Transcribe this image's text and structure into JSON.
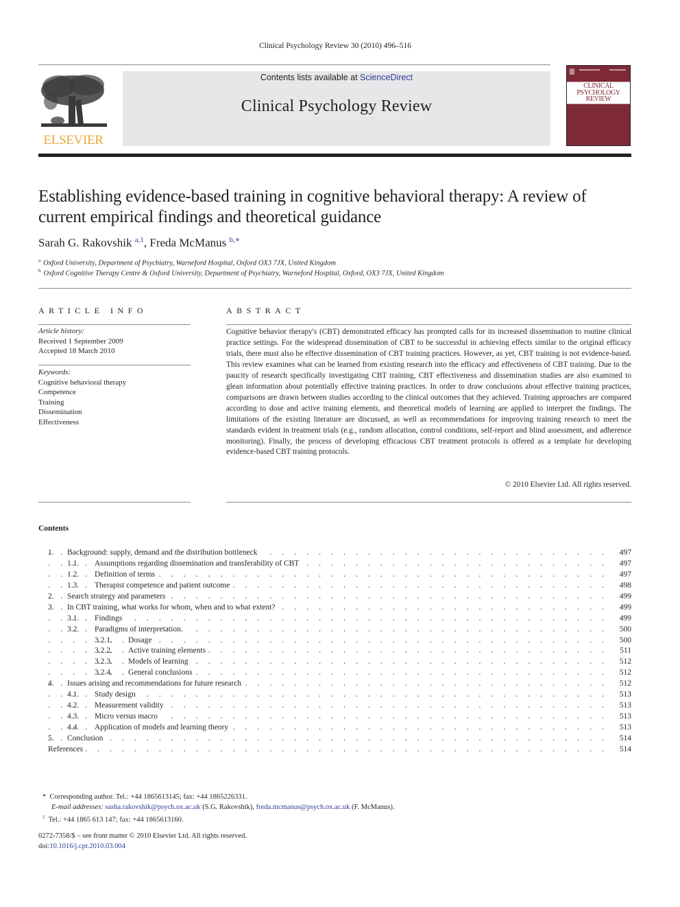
{
  "header": {
    "citation": "Clinical Psychology Review 30 (2010) 496–516",
    "contents_available_prefix": "Contents lists available at ",
    "sciencedirect_link": "ScienceDirect",
    "journal_title": "Clinical Psychology Review",
    "publisher_logo_text": "ELSEVIER",
    "cover_title_lines": [
      "CLINICAL",
      "PSYCHOLOGY",
      "REVIEW"
    ]
  },
  "article": {
    "title": "Establishing evidence-based training in cognitive behavioral therapy: A review of current empirical findings and theoretical guidance",
    "authors": [
      {
        "name": "Sarah G. Rakovshik",
        "sup": "a,1"
      },
      {
        "name": "Freda McManus",
        "sup": "b,∗"
      }
    ],
    "author_separator": ", ",
    "affiliations": [
      {
        "mark": "a",
        "text": "Oxford University, Department of Psychiatry, Warneford Hospital, Oxford OX3 7JX, United Kingdom"
      },
      {
        "mark": "b",
        "text": "Oxford Cognitive Therapy Centre & Oxford University, Department of Psychiatry, Warneford Hospital, Oxford, OX3 7JX, United Kingdom"
      }
    ]
  },
  "article_info": {
    "heading": "ARTICLE INFO",
    "history_label": "Article history:",
    "received": "Received 1 September 2009",
    "accepted": "Accepted 18 March 2010",
    "keywords_label": "Keywords:",
    "keywords": [
      "Cognitive behavioral therapy",
      "Competence",
      "Training",
      "Dissemination",
      "Effectiveness"
    ]
  },
  "abstract": {
    "heading": "ABSTRACT",
    "text": "Cognitive behavior therapy's (CBT) demonstrated efficacy has prompted calls for its increased dissemination to routine clinical practice settings. For the widespread dissemination of CBT to be successful in achieving effects similar to the original efficacy trials, there must also be effective dissemination of CBT training practices. However, as yet, CBT training is not evidence-based. This review examines what can be learned from existing research into the efficacy and effectiveness of CBT training. Due to the paucity of research specifically investigating CBT training, CBT effectiveness and dissemination studies are also examined to glean information about potentially effective training practices. In order to draw conclusions about effective training practices, comparisons are drawn between studies according to the clinical outcomes that they achieved. Training approaches are compared according to dose and active training elements, and theoretical models of learning are applied to interpret the findings. The limitations of the existing literature are discussed, as well as recommendations for improving training research to meet the standards evident in treatment trials (e.g., random allocation, control conditions, self-report and blind assessment, and adherence monitoring). Finally, the process of developing efficacious CBT treatment protocols is offered as a template for developing evidence-based CBT training protocols.",
    "copyright": "© 2010 Elsevier Ltd. All rights reserved."
  },
  "contents": {
    "heading": "Contents",
    "dots": ". . . . . . . . . . . . . . . . . . . . . . . . . . . . . . . . . . . . . . . . . . . . . . . . . . . . . . . . . . . . . . . . . . . . . . . . . . . . . . . . . . . .",
    "items": [
      {
        "level": 1,
        "num": "1.",
        "title": "Background: supply, demand and the distribution bottleneck",
        "page": "497"
      },
      {
        "level": 2,
        "num": "1.1.",
        "title": "Assumptions regarding dissemination and transferability of CBT",
        "page": "497"
      },
      {
        "level": 2,
        "num": "1.2.",
        "title": "Definition of terms",
        "page": "497"
      },
      {
        "level": 2,
        "num": "1.3.",
        "title": "Therapist competence and patient outcome",
        "page": "498"
      },
      {
        "level": 1,
        "num": "2.",
        "title": "Search strategy and parameters",
        "page": "499"
      },
      {
        "level": 1,
        "num": "3.",
        "title": "In CBT training, what works for whom, when and to what extent?",
        "page": "499"
      },
      {
        "level": 2,
        "num": "3.1.",
        "title": "Findings",
        "page": "499"
      },
      {
        "level": 2,
        "num": "3.2.",
        "title": "Paradigms of interpretation.",
        "page": "500"
      },
      {
        "level": 3,
        "num": "3.2.1.",
        "title": "Dosage",
        "page": "500"
      },
      {
        "level": 3,
        "num": "3.2.2.",
        "title": "Active training elements",
        "page": "511"
      },
      {
        "level": 3,
        "num": "3.2.3.",
        "title": "Models of learning",
        "page": "512"
      },
      {
        "level": 3,
        "num": "3.2.4.",
        "title": "General conclusions",
        "page": "512"
      },
      {
        "level": 1,
        "num": "4.",
        "title": "Issues arising and recommendations for future research",
        "page": "512"
      },
      {
        "level": 2,
        "num": "4.1.",
        "title": "Study design",
        "page": "513"
      },
      {
        "level": 2,
        "num": "4.2.",
        "title": "Measurement validity",
        "page": "513"
      },
      {
        "level": 2,
        "num": "4.3.",
        "title": "Micro versus macro",
        "page": "513"
      },
      {
        "level": 2,
        "num": "4.4.",
        "title": "Application of models and learning theory",
        "page": "513"
      },
      {
        "level": 1,
        "num": "5.",
        "title": "Conclusion",
        "page": "514"
      },
      {
        "level": 0,
        "num": "",
        "title": "References",
        "page": "514"
      }
    ]
  },
  "footnotes": {
    "corresponding_mark": "*",
    "corresponding": "Corresponding author. Tel.: +44 1865613145; fax: +44 1865226331.",
    "email_label": "E-mail addresses:",
    "email1": "sasha.rakovshik@psych.ox.ac.uk",
    "email1_name": " (S.G. Rakovshik), ",
    "email2": "freda.mcmanus@psych.ox.ac.uk",
    "email2_name": " (F. McManus).",
    "note1_mark": "1",
    "note1": "Tel.: +44 1865 613 147; fax: +44 1865613160."
  },
  "front_matter": {
    "issn_line": "0272-7358/$ – see front matter © 2010 Elsevier Ltd. All rights reserved.",
    "doi_prefix": "doi:",
    "doi": "10.1016/j.cpr.2010.03.004"
  },
  "colors": {
    "link": "#2f3a96",
    "cover": "#7e2a36",
    "elsevier_orange": "#e8a83c",
    "banner_bg": "#e6e7e8"
  }
}
